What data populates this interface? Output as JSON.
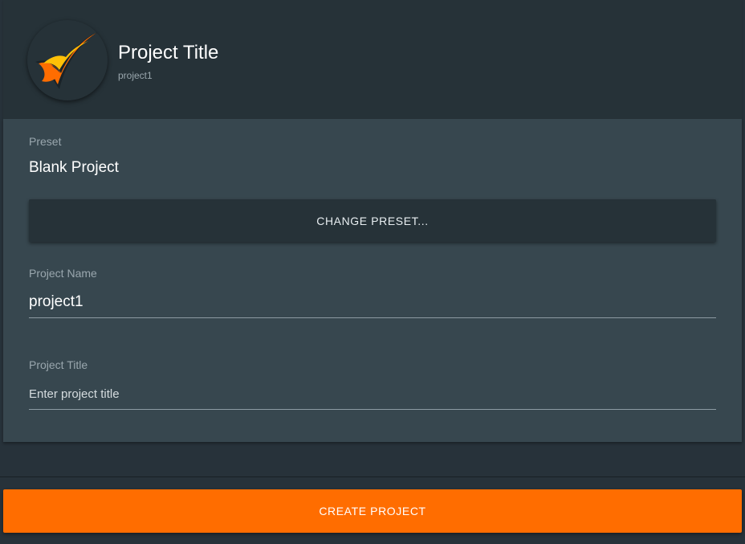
{
  "header": {
    "title": "Project Title",
    "subtitle": "project1",
    "logo_icon": "flame-swoosh-logo-icon"
  },
  "form": {
    "preset_label": "Preset",
    "preset_value": "Blank Project",
    "change_preset_label": "CHANGE PRESET...",
    "project_name_label": "Project Name",
    "project_name_value": "project1",
    "project_title_label": "Project Title",
    "project_title_value": "",
    "project_title_placeholder": "Enter project title"
  },
  "footer": {
    "create_label": "CREATE PROJECT"
  },
  "colors": {
    "accent": "#ff6d00",
    "header_bg": "#263238",
    "panel_bg": "#37474f",
    "logo_orange": "#ff6d00",
    "logo_yellow": "#ffc107"
  }
}
